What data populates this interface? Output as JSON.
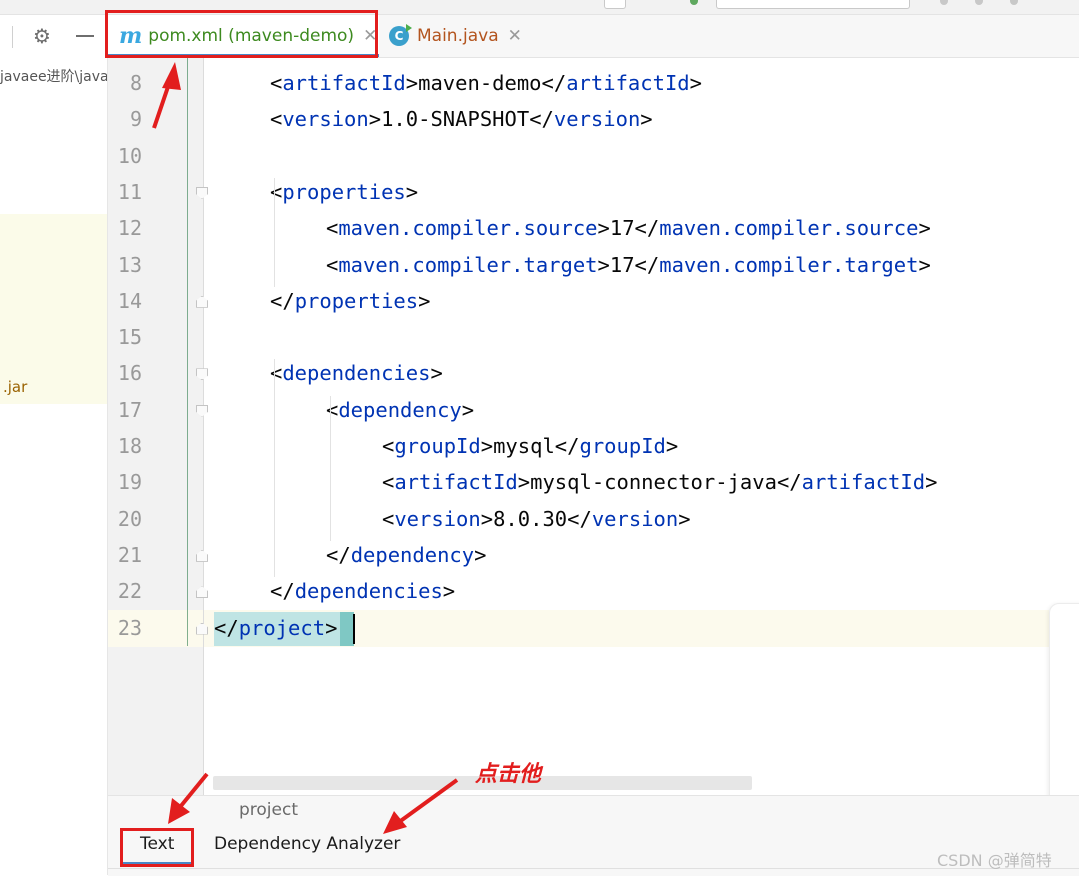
{
  "left_panel": {
    "path_text": "javaee进阶\\java",
    "jar_text": ".jar"
  },
  "tabs": [
    {
      "icon": "maven-icon",
      "icon_glyph": "m",
      "label": "pom.xml (maven-demo)",
      "active": true
    },
    {
      "icon": "java-class-icon",
      "icon_glyph": "C",
      "label": "Main.java",
      "active": false
    }
  ],
  "editor": {
    "lines": [
      {
        "num": "8",
        "indent": 1,
        "parts": [
          [
            "t",
            "<"
          ],
          [
            "g",
            "artifactId"
          ],
          [
            "t",
            ">maven-demo</"
          ],
          [
            "g",
            "artifactId"
          ],
          [
            "t",
            ">"
          ]
        ]
      },
      {
        "num": "9",
        "indent": 1,
        "parts": [
          [
            "t",
            "<"
          ],
          [
            "g",
            "version"
          ],
          [
            "t",
            ">1.0-SNAPSHOT</"
          ],
          [
            "g",
            "version"
          ],
          [
            "t",
            ">"
          ]
        ]
      },
      {
        "num": "10",
        "indent": 0,
        "parts": []
      },
      {
        "num": "11",
        "indent": 1,
        "parts": [
          [
            "t",
            "<"
          ],
          [
            "g",
            "properties"
          ],
          [
            "t",
            ">"
          ]
        ]
      },
      {
        "num": "12",
        "indent": 2,
        "parts": [
          [
            "t",
            "<"
          ],
          [
            "g",
            "maven.compiler.source"
          ],
          [
            "t",
            ">17</"
          ],
          [
            "g",
            "maven.compiler.source"
          ],
          [
            "t",
            ">"
          ]
        ]
      },
      {
        "num": "13",
        "indent": 2,
        "parts": [
          [
            "t",
            "<"
          ],
          [
            "g",
            "maven.compiler.target"
          ],
          [
            "t",
            ">17</"
          ],
          [
            "g",
            "maven.compiler.target"
          ],
          [
            "t",
            ">"
          ]
        ]
      },
      {
        "num": "14",
        "indent": 1,
        "parts": [
          [
            "t",
            "</"
          ],
          [
            "g",
            "properties"
          ],
          [
            "t",
            ">"
          ]
        ]
      },
      {
        "num": "15",
        "indent": 0,
        "parts": []
      },
      {
        "num": "16",
        "indent": 1,
        "parts": [
          [
            "t",
            "<"
          ],
          [
            "g",
            "dependencies"
          ],
          [
            "t",
            ">"
          ]
        ]
      },
      {
        "num": "17",
        "indent": 2,
        "parts": [
          [
            "t",
            "<"
          ],
          [
            "g",
            "dependency"
          ],
          [
            "t",
            ">"
          ]
        ]
      },
      {
        "num": "18",
        "indent": 3,
        "parts": [
          [
            "t",
            "<"
          ],
          [
            "g",
            "groupId"
          ],
          [
            "t",
            ">mysql</"
          ],
          [
            "g",
            "groupId"
          ],
          [
            "t",
            ">"
          ]
        ]
      },
      {
        "num": "19",
        "indent": 3,
        "parts": [
          [
            "t",
            "<"
          ],
          [
            "g",
            "artifactId"
          ],
          [
            "t",
            ">mysql-connector-java</"
          ],
          [
            "g",
            "artifactId"
          ],
          [
            "t",
            ">"
          ]
        ]
      },
      {
        "num": "20",
        "indent": 3,
        "parts": [
          [
            "t",
            "<"
          ],
          [
            "g",
            "version"
          ],
          [
            "t",
            ">8.0.30</"
          ],
          [
            "g",
            "version"
          ],
          [
            "t",
            ">"
          ]
        ]
      },
      {
        "num": "21",
        "indent": 2,
        "parts": [
          [
            "t",
            "</"
          ],
          [
            "g",
            "dependency"
          ],
          [
            "t",
            ">"
          ]
        ]
      },
      {
        "num": "22",
        "indent": 1,
        "parts": [
          [
            "t",
            "</"
          ],
          [
            "g",
            "dependencies"
          ],
          [
            "t",
            ">"
          ]
        ]
      },
      {
        "num": "23",
        "indent": 0,
        "parts": [
          [
            "t",
            "</"
          ],
          [
            "g",
            "project"
          ],
          [
            "t",
            ">"
          ]
        ]
      }
    ]
  },
  "bottom": {
    "breadcrumb": "project",
    "tabs": [
      "Text",
      "Dependency Analyzer"
    ],
    "active_tab": "Text"
  },
  "annotation": "点击他",
  "watermark": "CSDN @弹简特",
  "colors": {
    "tag": "#0033b3",
    "text": "#080808",
    "accent": "#e21e1e",
    "tab_underline": "#4a88c7"
  }
}
